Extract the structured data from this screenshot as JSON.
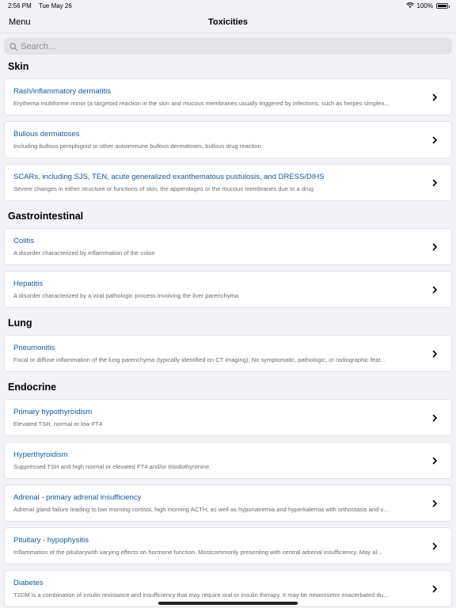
{
  "status": {
    "time": "2:56 PM",
    "date": "Tue May 26",
    "battery": "100%"
  },
  "nav": {
    "menu_label": "Menu",
    "title": "Toxicities"
  },
  "search": {
    "placeholder": "Search..."
  },
  "sections": [
    {
      "title": "Skin",
      "items": [
        {
          "title": "Rash/inflammatory dermatitis",
          "desc": "Erythema multiforme minor (a targetoid reaction in the skin and mucous membranes usually triggered by infections, such as herpes simplex..."
        },
        {
          "title": "Bullous dermatoses",
          "desc": "Including bullous pemphigoid or other autoimmune bullous dermatoses, bullous drug reaction"
        },
        {
          "title": "SCARs, including SJS, TEN, acute generalized exanthematous pustulosis, and DRESS/DIHS",
          "desc": "Severe changes in either structure or functions of skin, the appendages or the mucous membranes due to a drug"
        }
      ]
    },
    {
      "title": "Gastrointestinal",
      "items": [
        {
          "title": "Colitis",
          "desc": "A disorder characterized by inflammation of the colon"
        },
        {
          "title": "Hepatitis",
          "desc": "A disorder characterized by a viral pathologic process involving the liver parenchyma"
        }
      ]
    },
    {
      "title": "Lung",
      "items": [
        {
          "title": "Pneumonitis",
          "desc": "Focal or diffuse inflammation of the lung parenchyma (typically identified on CT imaging); No symptomatic, pathologic, or radiographic feat..."
        }
      ]
    },
    {
      "title": "Endocrine",
      "items": [
        {
          "title": "Primary hypothyroidism",
          "desc": "Elevated TSH, normal or low FT4"
        },
        {
          "title": "Hyperthyroidism",
          "desc": "Suppressed TSH and high normal or elevated FT4 and/or triiodothyronine"
        },
        {
          "title": "Adrenal - primary adrenal insufficiency",
          "desc": "Adrenal gland failure leading to low morning cortisol, high morning ACTH, as well as hyponatremia and hyperkalemia with orthostasis and v..."
        },
        {
          "title": "Pituitary - hypophysitis",
          "desc": "Inflammation of the pituitarywith varying effects on hormone function. Mostcommonly presenting with central adrenal insufficiency. May al..."
        },
        {
          "title": "Diabetes",
          "desc": "T2DM is a combination of insulin resistance and insufficiency that may require oral or insulin therapy. It may be newonsetor exacerbated du..."
        }
      ]
    }
  ]
}
